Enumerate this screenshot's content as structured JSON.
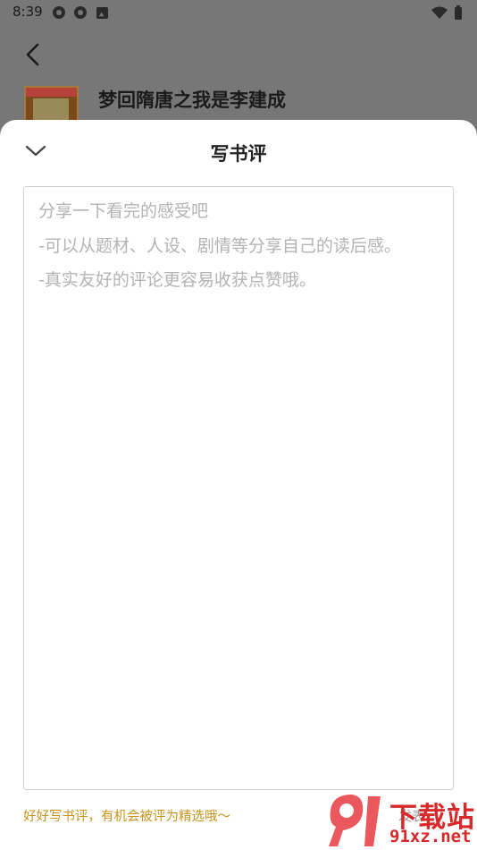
{
  "status_bar": {
    "time": "8:39"
  },
  "background": {
    "book_title": "梦回隋唐之我是李建成"
  },
  "sheet": {
    "title": "写书评",
    "placeholder": "分享一下看完的感受吧\n-可以从题材、人设、剧情等分享自己的读后感。\n-真实友好的评论更容易收获点赞哦。",
    "hint": "好好写书评，有机会被评为精选哦～",
    "publish_label": "发表"
  },
  "watermark": {
    "brand": "下载站",
    "url": "91xz.net"
  },
  "colors": {
    "hint": "#c8921c",
    "watermark": "#d7282a",
    "overlay": "#777777"
  },
  "icons": [
    "back-icon",
    "chevron-down-icon",
    "wifi-icon",
    "battery-icon"
  ]
}
